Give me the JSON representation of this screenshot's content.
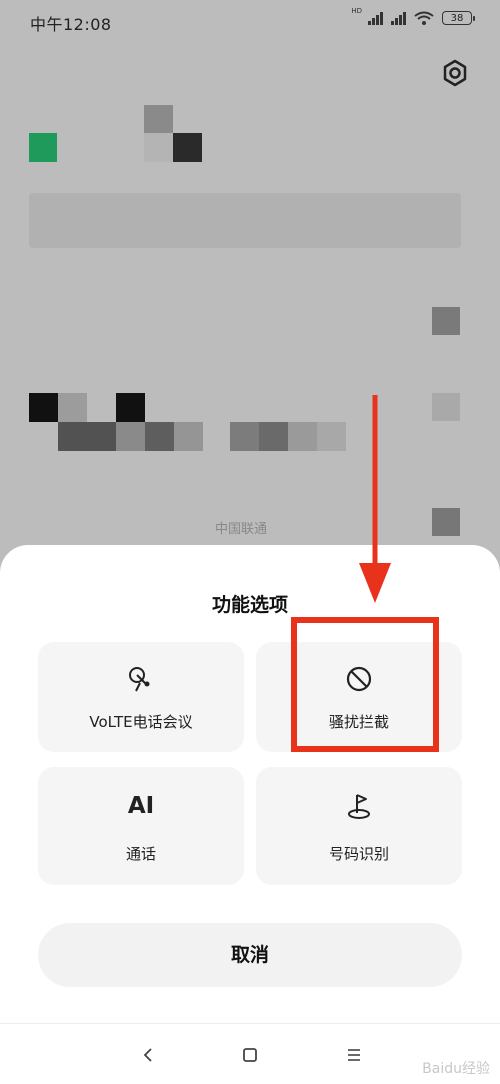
{
  "status_bar": {
    "time": "中午12:08",
    "network": "HD",
    "battery": "38"
  },
  "sheet": {
    "title": "功能选项",
    "options": [
      {
        "label": "VoLTE电话会议",
        "icon": "satellite-dish-icon"
      },
      {
        "label": "骚扰拦截",
        "icon": "block-icon"
      },
      {
        "label_top": "AI",
        "label": "通话",
        "icon": "ai-text-icon"
      },
      {
        "label": "号码识别",
        "icon": "location-flag-icon"
      }
    ],
    "cancel_label": "取消"
  },
  "background_text": "中国联通",
  "watermark": "Baidu经验",
  "colors": {
    "accent_red": "#e8321c",
    "green_block": "#1f9a5a"
  }
}
